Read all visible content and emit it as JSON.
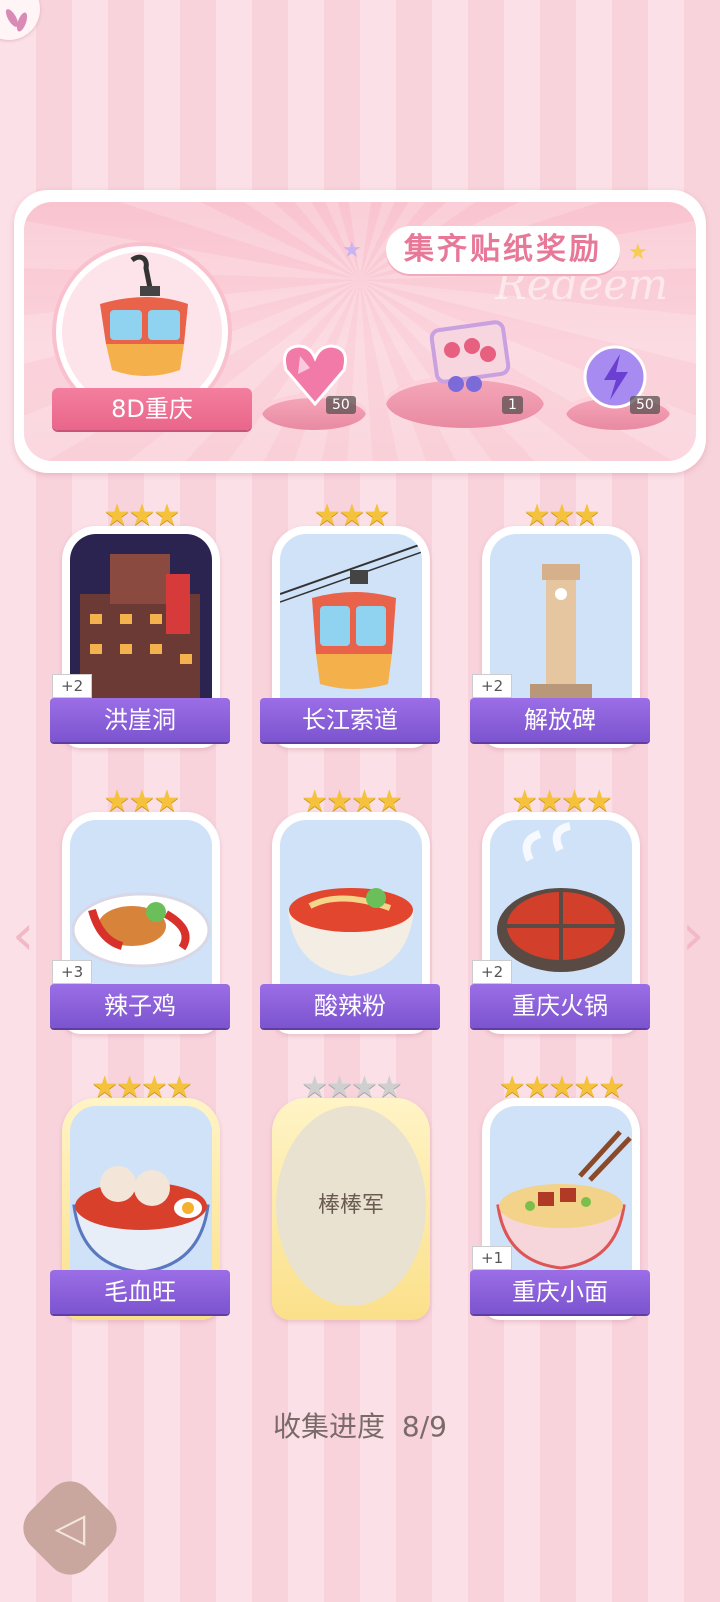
{
  "reward": {
    "title": "集齐贴纸奖励",
    "watermark": "Redeem",
    "city": "8D重庆",
    "items": [
      {
        "name": "pink-diamond",
        "count": "50"
      },
      {
        "name": "gift-box",
        "count": "1"
      },
      {
        "name": "energy-orb",
        "count": "50"
      }
    ]
  },
  "cards": [
    {
      "title": "洪崖洞",
      "stars": 3,
      "bonus": "+2"
    },
    {
      "title": "长江索道",
      "stars": 3,
      "bonus": ""
    },
    {
      "title": "解放碑",
      "stars": 3,
      "bonus": "+2"
    },
    {
      "title": "辣子鸡",
      "stars": 3,
      "bonus": "+3"
    },
    {
      "title": "酸辣粉",
      "stars": 4,
      "bonus": ""
    },
    {
      "title": "重庆火锅",
      "stars": 4,
      "bonus": "+2"
    },
    {
      "title": "毛血旺",
      "stars": 4,
      "bonus": ""
    },
    {
      "title": "棒棒军",
      "stars": 4,
      "bonus": "",
      "locked": true
    },
    {
      "title": "重庆小面",
      "stars": 5,
      "bonus": "+1"
    }
  ],
  "progress": {
    "label": "收集进度",
    "value": "8/9"
  }
}
